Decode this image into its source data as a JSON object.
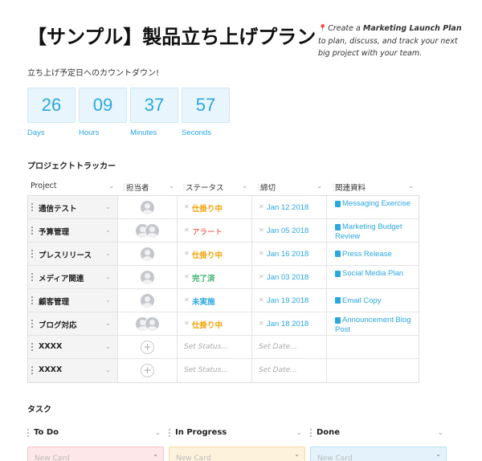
{
  "header": {
    "title": "【サンプル】製品立ち上げプラン",
    "note_prefix": "Create a ",
    "note_bold": "Marketing Launch Plan",
    "note_suffix": " to plan, discuss, and track your next big project with your team."
  },
  "countdown": {
    "label": "立ち上げ予定日へのカウントダウン!",
    "units": [
      {
        "value": "26",
        "caption": "Days"
      },
      {
        "value": "09",
        "caption": "Hours"
      },
      {
        "value": "37",
        "caption": "Minutes"
      },
      {
        "value": "57",
        "caption": "Seconds"
      }
    ]
  },
  "tracker": {
    "heading": "プロジェクトトラッカー",
    "columns": [
      "Project",
      "担当者",
      "ステータス",
      "締切",
      "関連資料"
    ],
    "rows": [
      {
        "project": "通信テスト",
        "status": "仕掛り中",
        "status_color": "#f0a000",
        "due": "Jan 12 2018",
        "doc": "Messaging Exercise"
      },
      {
        "project": "予算管理",
        "status": "アラート",
        "status_color": "#e8413c",
        "due": "Jan 05 2018",
        "doc": "Marketing Budget Review"
      },
      {
        "project": "プレスリリース",
        "status": "仕掛り中",
        "status_color": "#f0a000",
        "due": "Jan 16 2018",
        "doc": "Press Release"
      },
      {
        "project": "メディア関連",
        "status": "完了済",
        "status_color": "#3cb371",
        "due": "Jan 03 2018",
        "doc": "Social Media Plan"
      },
      {
        "project": "顧客管理",
        "status": "未実施",
        "status_color": "#2aa7df",
        "due": "Jan 19 2018",
        "doc": "Email Copy"
      },
      {
        "project": "ブログ対応",
        "status": "仕掛り中",
        "status_color": "#f0a000",
        "due": "Jan 18 2018",
        "doc": "Announcement Blog Post"
      },
      {
        "project": "XXXX",
        "status_placeholder": "Set Status...",
        "due_placeholder": "Set Date..."
      },
      {
        "project": "XXXX",
        "status_placeholder": "Set Status...",
        "due_placeholder": "Set Date..."
      }
    ]
  },
  "tasks": {
    "heading": "タスク",
    "columns": [
      {
        "name": "To Do",
        "card": "New Card",
        "color": "#fde7e8",
        "border": "#f7c4c6"
      },
      {
        "name": "In Progress",
        "card": "New Card",
        "color": "#fdf3dc",
        "border": "#f5dfa6"
      },
      {
        "name": "Done",
        "card": "New Card",
        "color": "#e3f2fb",
        "border": "#bddff2"
      }
    ]
  }
}
